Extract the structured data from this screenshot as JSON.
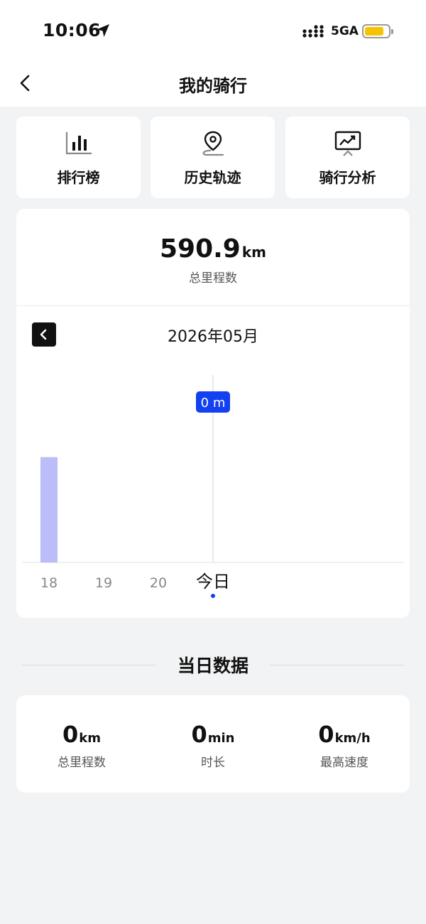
{
  "status_bar": {
    "time": "10:06",
    "network": "5GA",
    "battery_level": 0.8
  },
  "nav": {
    "title": "我的骑行"
  },
  "quick_actions": [
    {
      "label": "排行榜",
      "icon": "bar-chart-icon"
    },
    {
      "label": "历史轨迹",
      "icon": "map-pin-icon"
    },
    {
      "label": "骑行分析",
      "icon": "analysis-screen-icon"
    }
  ],
  "summary": {
    "total_value": "590.9",
    "total_unit": "km",
    "total_label": "总里程数"
  },
  "calendar": {
    "month": "2026年05月"
  },
  "chart_data": {
    "type": "bar",
    "categories": [
      "18",
      "19",
      "20",
      "今日"
    ],
    "values": [
      2.3,
      0,
      0,
      0
    ],
    "selected_label": "0 m",
    "selected_index": 3,
    "colors": {
      "bar": "#babdf7",
      "selected": "#1340f0"
    }
  },
  "day_section": {
    "title": "当日数据"
  },
  "day_stats": [
    {
      "value": "0",
      "unit": "km",
      "label": "总里程数"
    },
    {
      "value": "0",
      "unit": "min",
      "label": "时长"
    },
    {
      "value": "0",
      "unit": "km/h",
      "label": "最高速度"
    }
  ],
  "colors": {
    "accent": "#1340f0",
    "bar": "#babdf7",
    "background": "#f2f3f5"
  }
}
